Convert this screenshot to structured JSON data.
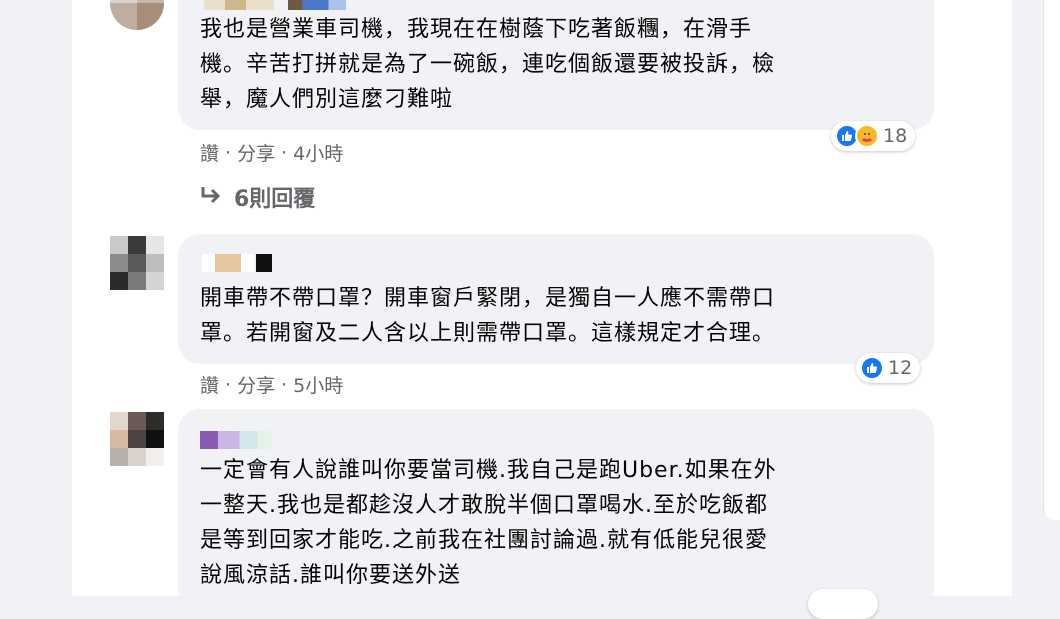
{
  "comments": [
    {
      "text_lines": [
        "我也是營業車司機，我現在在樹蔭下吃著飯糰，在滑手",
        "機。辛苦打拼就是為了一碗飯，連吃個飯還要被投訴，檢",
        "舉，魔人們別這麼刁難啦"
      ],
      "actions": {
        "like": "讚",
        "sep1": "·",
        "share": "分享",
        "sep2": "·",
        "time": "4小時"
      },
      "reaction_count": "18",
      "reactions": [
        "like",
        "care"
      ],
      "replies_label": "6則回覆"
    },
    {
      "text_lines": [
        "開車帶不帶口罩？開車窗戶緊閉，是獨自一人應不需帶口",
        "罩。若開窗及二人含以上則需帶口罩。這樣規定才合理。"
      ],
      "actions": {
        "like": "讚",
        "sep1": "·",
        "share": "分享",
        "sep2": "·",
        "time": "5小時"
      },
      "reaction_count": "12",
      "reactions": [
        "like"
      ]
    },
    {
      "text_lines": [
        "一定會有人說誰叫你要當司機.我自己是跑Uber.如果在外",
        "一整天.我也是都趁沒人才敢脫半個口罩喝水.至於吃飯都",
        "是等到回家才能吃.之前我在社團討論過.就有低能兒很愛",
        "說風涼話.誰叫你要送外送"
      ]
    }
  ],
  "colors": {
    "page_bg": "#f0f2f5",
    "bubble_bg": "#f0f2f5",
    "meta_text": "#65676b",
    "like_blue": "#1877f2",
    "care_yellow": "#f7b928"
  }
}
